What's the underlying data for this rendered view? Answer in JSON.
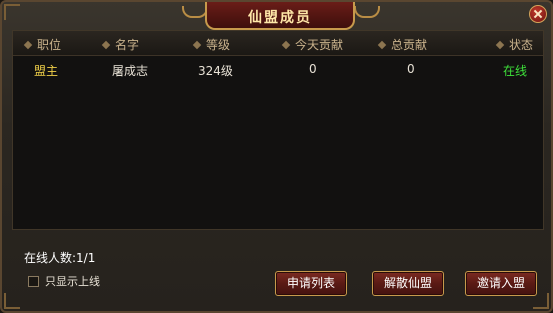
{
  "window": {
    "title": "仙盟成员"
  },
  "table": {
    "columns": [
      "职位",
      "名字",
      "等级",
      "今天贡献",
      "总贡献",
      "状态"
    ],
    "rows": [
      {
        "role": "盟主",
        "name": "屠成志",
        "level": "324级",
        "today_contribution": "0",
        "total_contribution": "0",
        "status": "在线"
      }
    ]
  },
  "footer": {
    "online_count": "在线人数:1/1",
    "show_online_only_label": "只显示上线",
    "show_online_only_checked": false,
    "apply_list_label": "申请列表",
    "disband_label": "解散仙盟",
    "invite_label": "邀请入盟"
  },
  "colors": {
    "role": "#f0d048",
    "status_online": "#3ee03a",
    "button_bg": "#5a1a14",
    "button_border": "#c79a4c"
  },
  "icons": {
    "close": "close-icon",
    "column_marker": "diamond-icon"
  }
}
